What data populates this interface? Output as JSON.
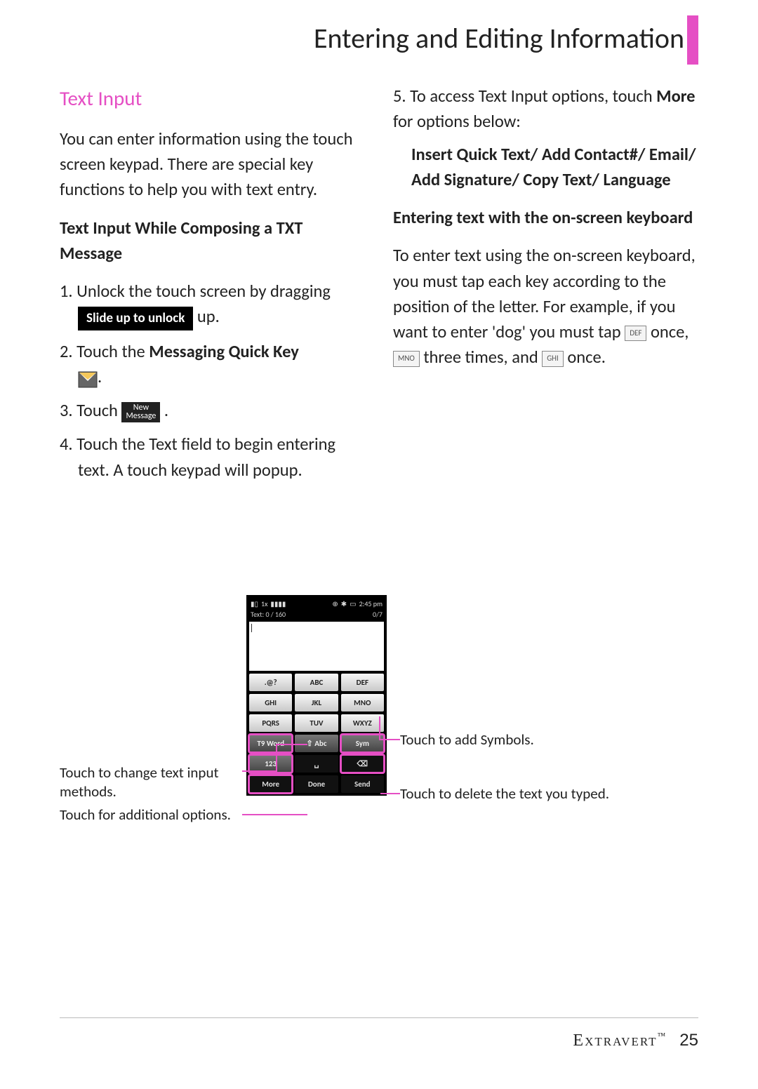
{
  "page_title": "Entering and Editing Information",
  "section_title": "Text Input",
  "intro": "You can enter information using the touch screen keypad. There are special key functions to help you with text entry.",
  "sub1": "Text Input While Composing a TXT Message",
  "step1_a": "1. Unlock the touch screen by dragging ",
  "step1_badge": "Slide up to unlock",
  "step1_b": " up.",
  "step2_a": "2. Touch the ",
  "step2_bold": "Messaging Quick Key",
  "step3_a": "3. Touch ",
  "newmsg_top": "New",
  "newmsg_bot": "Message",
  "step4": "4. Touch the Text field to begin entering text. A touch keypad will popup.",
  "step5_a": "5. To access Text Input options, touch ",
  "step5_bold": "More",
  "step5_b": " for options below:",
  "options": "Insert Quick Text/ Add Contact#/ Email/ Add Signature/ Copy Text/ Language",
  "sub2": "Entering text with the on-screen keyboard",
  "para2_a": "To enter text using the on-screen keyboard, you must tap each key according to the position of the letter. For example, if you want to enter 'dog' you must tap ",
  "key_def": "DEF",
  "para2_b": " once, ",
  "key_mno": "MNO",
  "para2_c": " three times, and ",
  "key_ghi": "GHI",
  "para2_d": " once.",
  "phone": {
    "time": "2:45 pm",
    "text_count": "Text: 0 / 160",
    "page_count": "0/7",
    "keys": {
      "r1": [
        ".@?",
        "ABC",
        "DEF"
      ],
      "r2": [
        "GHI",
        "JKL",
        "MNO"
      ],
      "r3": [
        "PQRS",
        "TUV",
        "WXYZ"
      ],
      "r4": [
        "T9 Word",
        "⇧ Abc",
        "Sym"
      ],
      "r5": [
        "123",
        "␣",
        "⌫"
      ],
      "r6": [
        "More",
        "Done",
        "Send"
      ]
    }
  },
  "callouts": {
    "left1": "Touch to change text input methods.",
    "left2": "Touch for additional options.",
    "right1": "Touch to add Symbols.",
    "right2": "Touch to delete the text you typed."
  },
  "footer_brand": "Extravert",
  "footer_page": "25"
}
